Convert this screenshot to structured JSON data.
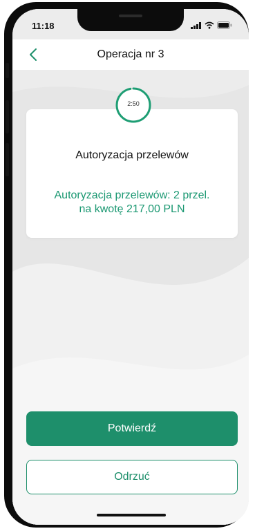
{
  "status_bar": {
    "time": "11:18",
    "icons": [
      "signal-icon",
      "wifi-icon",
      "battery-icon"
    ]
  },
  "header": {
    "back_icon": "chevron-left-icon",
    "title": "Operacja nr 3"
  },
  "timer": {
    "remaining": "2:50",
    "ring_color": "#1e9e74",
    "progress_fraction": 0.97
  },
  "authorization": {
    "title": "Autoryzacja przelewów",
    "message": "Autoryzacja przelewów: 2 przel. na kwotę 217,00 PLN"
  },
  "actions": {
    "confirm_label": "Potwierdź",
    "reject_label": "Odrzuć"
  },
  "colors": {
    "accent": "#1e8f6b",
    "message_text": "#1b9872"
  }
}
